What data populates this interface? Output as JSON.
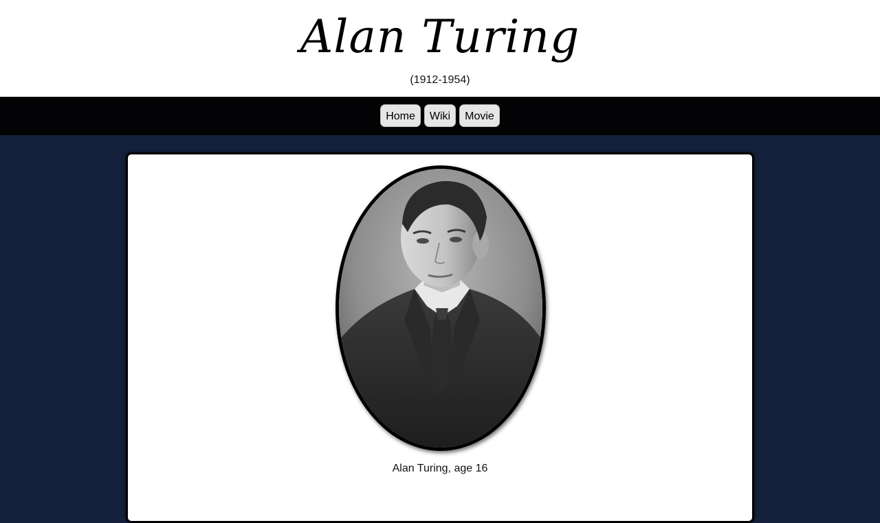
{
  "header": {
    "title": "Alan Turing",
    "dates": "(1912-1954)"
  },
  "nav": {
    "items": [
      {
        "label": "Home"
      },
      {
        "label": "Wiki"
      },
      {
        "label": "Movie"
      }
    ]
  },
  "main": {
    "portrait_description": "portrait-photo",
    "caption": "Alan Turing, age 16"
  },
  "colors": {
    "page_background": "#15213c",
    "navbar_background": "#030306",
    "nav_button_background": "#e6e6e6",
    "card_background": "#ffffff",
    "header_background": "#ffffff"
  }
}
